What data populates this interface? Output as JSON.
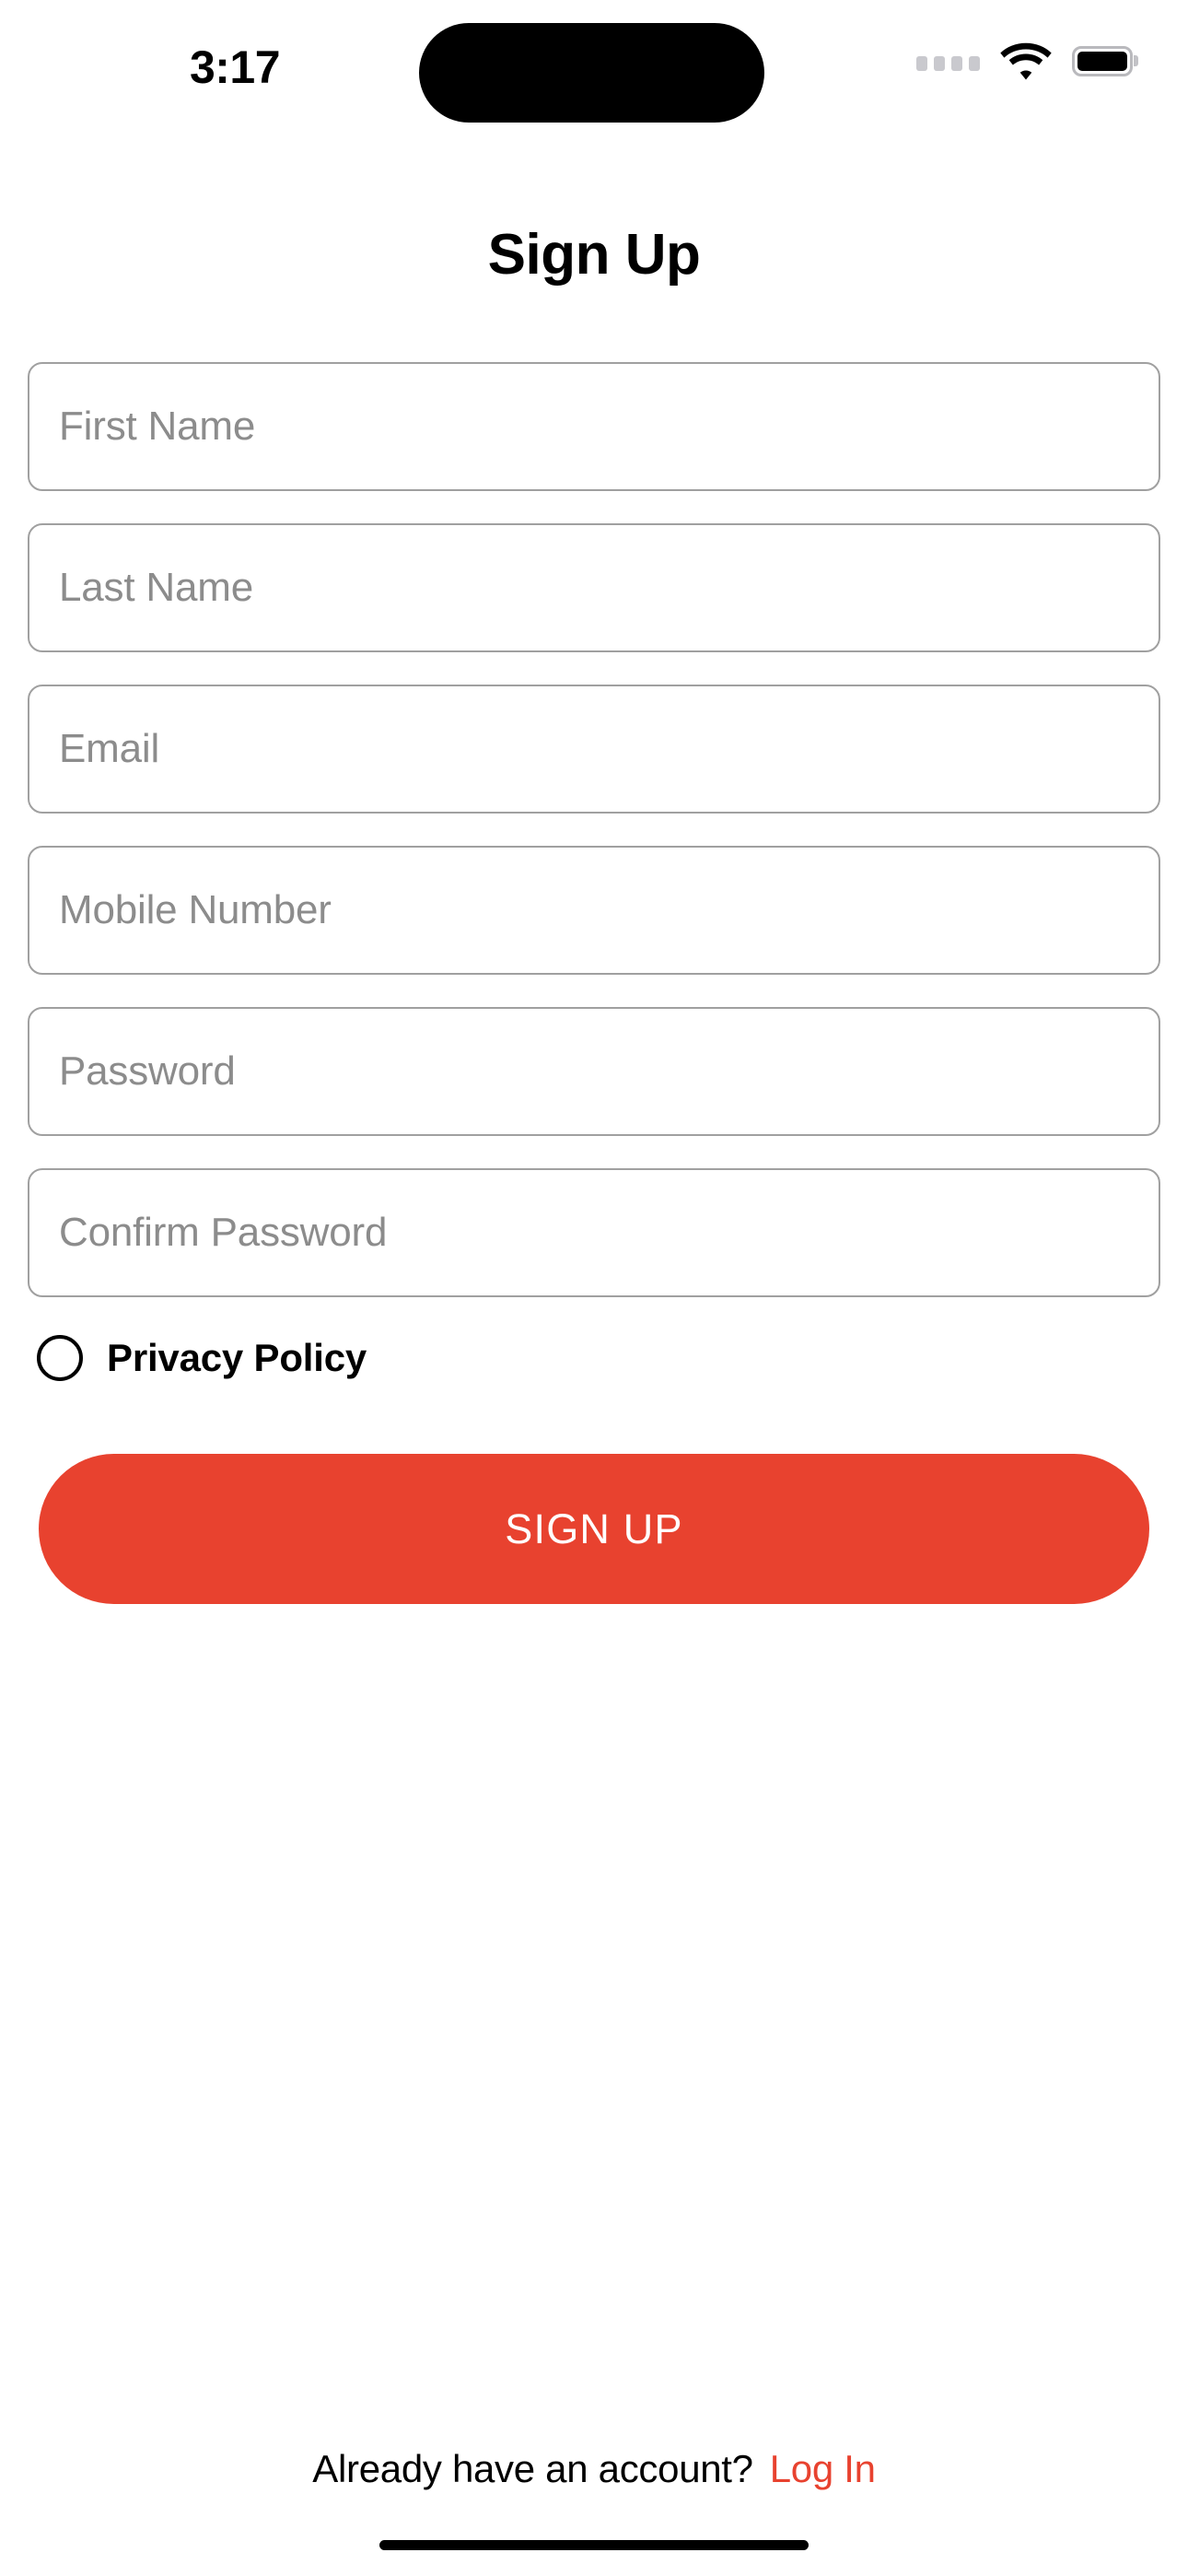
{
  "status_bar": {
    "time": "3:17",
    "cellular_icon": "cellular-dots-icon",
    "wifi_icon": "wifi-icon",
    "battery_icon": "battery-full-icon"
  },
  "header": {
    "title": "Sign Up"
  },
  "form": {
    "fields": [
      {
        "name": "first-name",
        "placeholder": "First Name",
        "value": ""
      },
      {
        "name": "last-name",
        "placeholder": "Last Name",
        "value": ""
      },
      {
        "name": "email",
        "placeholder": "Email",
        "value": ""
      },
      {
        "name": "mobile-number",
        "placeholder": "Mobile Number",
        "value": ""
      },
      {
        "name": "password",
        "placeholder": "Password",
        "value": ""
      },
      {
        "name": "confirm-password",
        "placeholder": "Confirm Password",
        "value": ""
      }
    ]
  },
  "privacy": {
    "label": "Privacy Policy",
    "checked": false,
    "radio_icon": "radio-unchecked-icon"
  },
  "primary_action": {
    "label": "SIGN UP"
  },
  "footer": {
    "prompt": "Already have an account?",
    "link_label": "Log In"
  },
  "colors": {
    "accent": "#e8422f",
    "text_primary": "#000000",
    "placeholder": "#8c8c8c",
    "field_border": "#a0a0a0",
    "background": "#ffffff"
  }
}
